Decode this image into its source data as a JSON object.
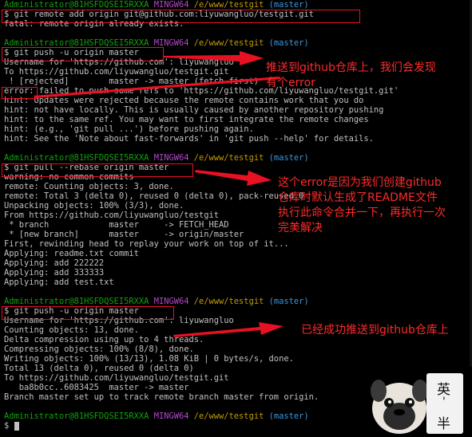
{
  "terminal": {
    "prompt": {
      "user": "Administrator@81HSFDQSEI5RXXA",
      "shell": "MINGW64",
      "path": "/e/www/testgit",
      "branch": "(master)",
      "dollar": "$"
    },
    "lines": [
      {
        "type": "prompt"
      },
      {
        "type": "cmd",
        "text": "$ git remote add origin git@github.com:liyuwangluo/testgit.git"
      },
      {
        "type": "out",
        "text": "fatal: remote origin already exists."
      },
      {
        "type": "blank"
      },
      {
        "type": "prompt"
      },
      {
        "type": "cmd",
        "text": "$ git push -u origin master"
      },
      {
        "type": "out",
        "text": "Username for 'https://github.com': liyuwangluo"
      },
      {
        "type": "out",
        "text": "To https://github.com/liyuwangluo/testgit.git"
      },
      {
        "type": "out",
        "text": " ! [rejected]        master -> master (fetch first)"
      },
      {
        "type": "out",
        "text": "error: failed to push some refs to 'https://github.com/liyuwangluo/testgit.git'"
      },
      {
        "type": "out",
        "text": "hint: Updates were rejected because the remote contains work that you do"
      },
      {
        "type": "out",
        "text": "hint: not have locally. This is usually caused by another repository pushing"
      },
      {
        "type": "out",
        "text": "hint: to the same ref. You may want to first integrate the remote changes"
      },
      {
        "type": "out",
        "text": "hint: (e.g., 'git pull ...') before pushing again."
      },
      {
        "type": "out",
        "text": "hint: See the 'Note about fast-forwards' in 'git push --help' for details."
      },
      {
        "type": "blank"
      },
      {
        "type": "prompt"
      },
      {
        "type": "cmd",
        "text": "$ git pull --rebase origin master"
      },
      {
        "type": "out",
        "text": "warning: no common commits"
      },
      {
        "type": "out",
        "text": "remote: Counting objects: 3, done."
      },
      {
        "type": "out",
        "text": "remote: Total 3 (delta 0), reused 0 (delta 0), pack-reused 0"
      },
      {
        "type": "out",
        "text": "Unpacking objects: 100% (3/3), done."
      },
      {
        "type": "out",
        "text": "From https://github.com/liyuwangluo/testgit"
      },
      {
        "type": "out",
        "text": " * branch            master     -> FETCH_HEAD"
      },
      {
        "type": "out",
        "text": " * [new branch]      master     -> origin/master"
      },
      {
        "type": "out",
        "text": "First, rewinding head to replay your work on top of it..."
      },
      {
        "type": "out",
        "text": "Applying: readme.txt commit"
      },
      {
        "type": "out",
        "text": "Applying: add 222222"
      },
      {
        "type": "out",
        "text": "Applying: add 333333"
      },
      {
        "type": "out",
        "text": "Applying: add test.txt"
      },
      {
        "type": "blank"
      },
      {
        "type": "prompt"
      },
      {
        "type": "cmd",
        "text": "$ git push -u origin master"
      },
      {
        "type": "out",
        "text": "Username for 'https://github.com': liyuwangluo"
      },
      {
        "type": "out",
        "text": "Counting objects: 13, done."
      },
      {
        "type": "out",
        "text": "Delta compression using up to 4 threads."
      },
      {
        "type": "out",
        "text": "Compressing objects: 100% (8/8), done."
      },
      {
        "type": "out",
        "text": "Writing objects: 100% (13/13), 1.08 KiB | 0 bytes/s, done."
      },
      {
        "type": "out",
        "text": "Total 13 (delta 0), reused 0 (delta 0)"
      },
      {
        "type": "out",
        "text": "To https://github.com/liyuwangluo/testgit.git"
      },
      {
        "type": "out",
        "text": "   ba8b0cc..6083425  master -> master"
      },
      {
        "type": "out",
        "text": "Branch master set up to track remote branch master from origin."
      },
      {
        "type": "blank"
      },
      {
        "type": "prompt"
      },
      {
        "type": "cursor",
        "text": "$ "
      }
    ]
  },
  "annotations": [
    {
      "text": "推送到github仓库上，我们会发现\n有个error"
    },
    {
      "text": "这个error是因为我们创建github\n仓库时默认生成了README文件\n执行此命令合并一下，再执行一次\n完美解决"
    },
    {
      "text": "已经成功推送到github仓库上"
    }
  ],
  "watermark": {
    "chars": [
      "英",
      "'",
      "半"
    ],
    "icon": "pug-dog-icon"
  },
  "colors": {
    "prompt_user": "#13a10e",
    "prompt_shell": "#b148c6",
    "prompt_path": "#c19c00",
    "prompt_branch": "#3a96dd",
    "annotation": "#ff2a2a",
    "box": "#e81123"
  }
}
